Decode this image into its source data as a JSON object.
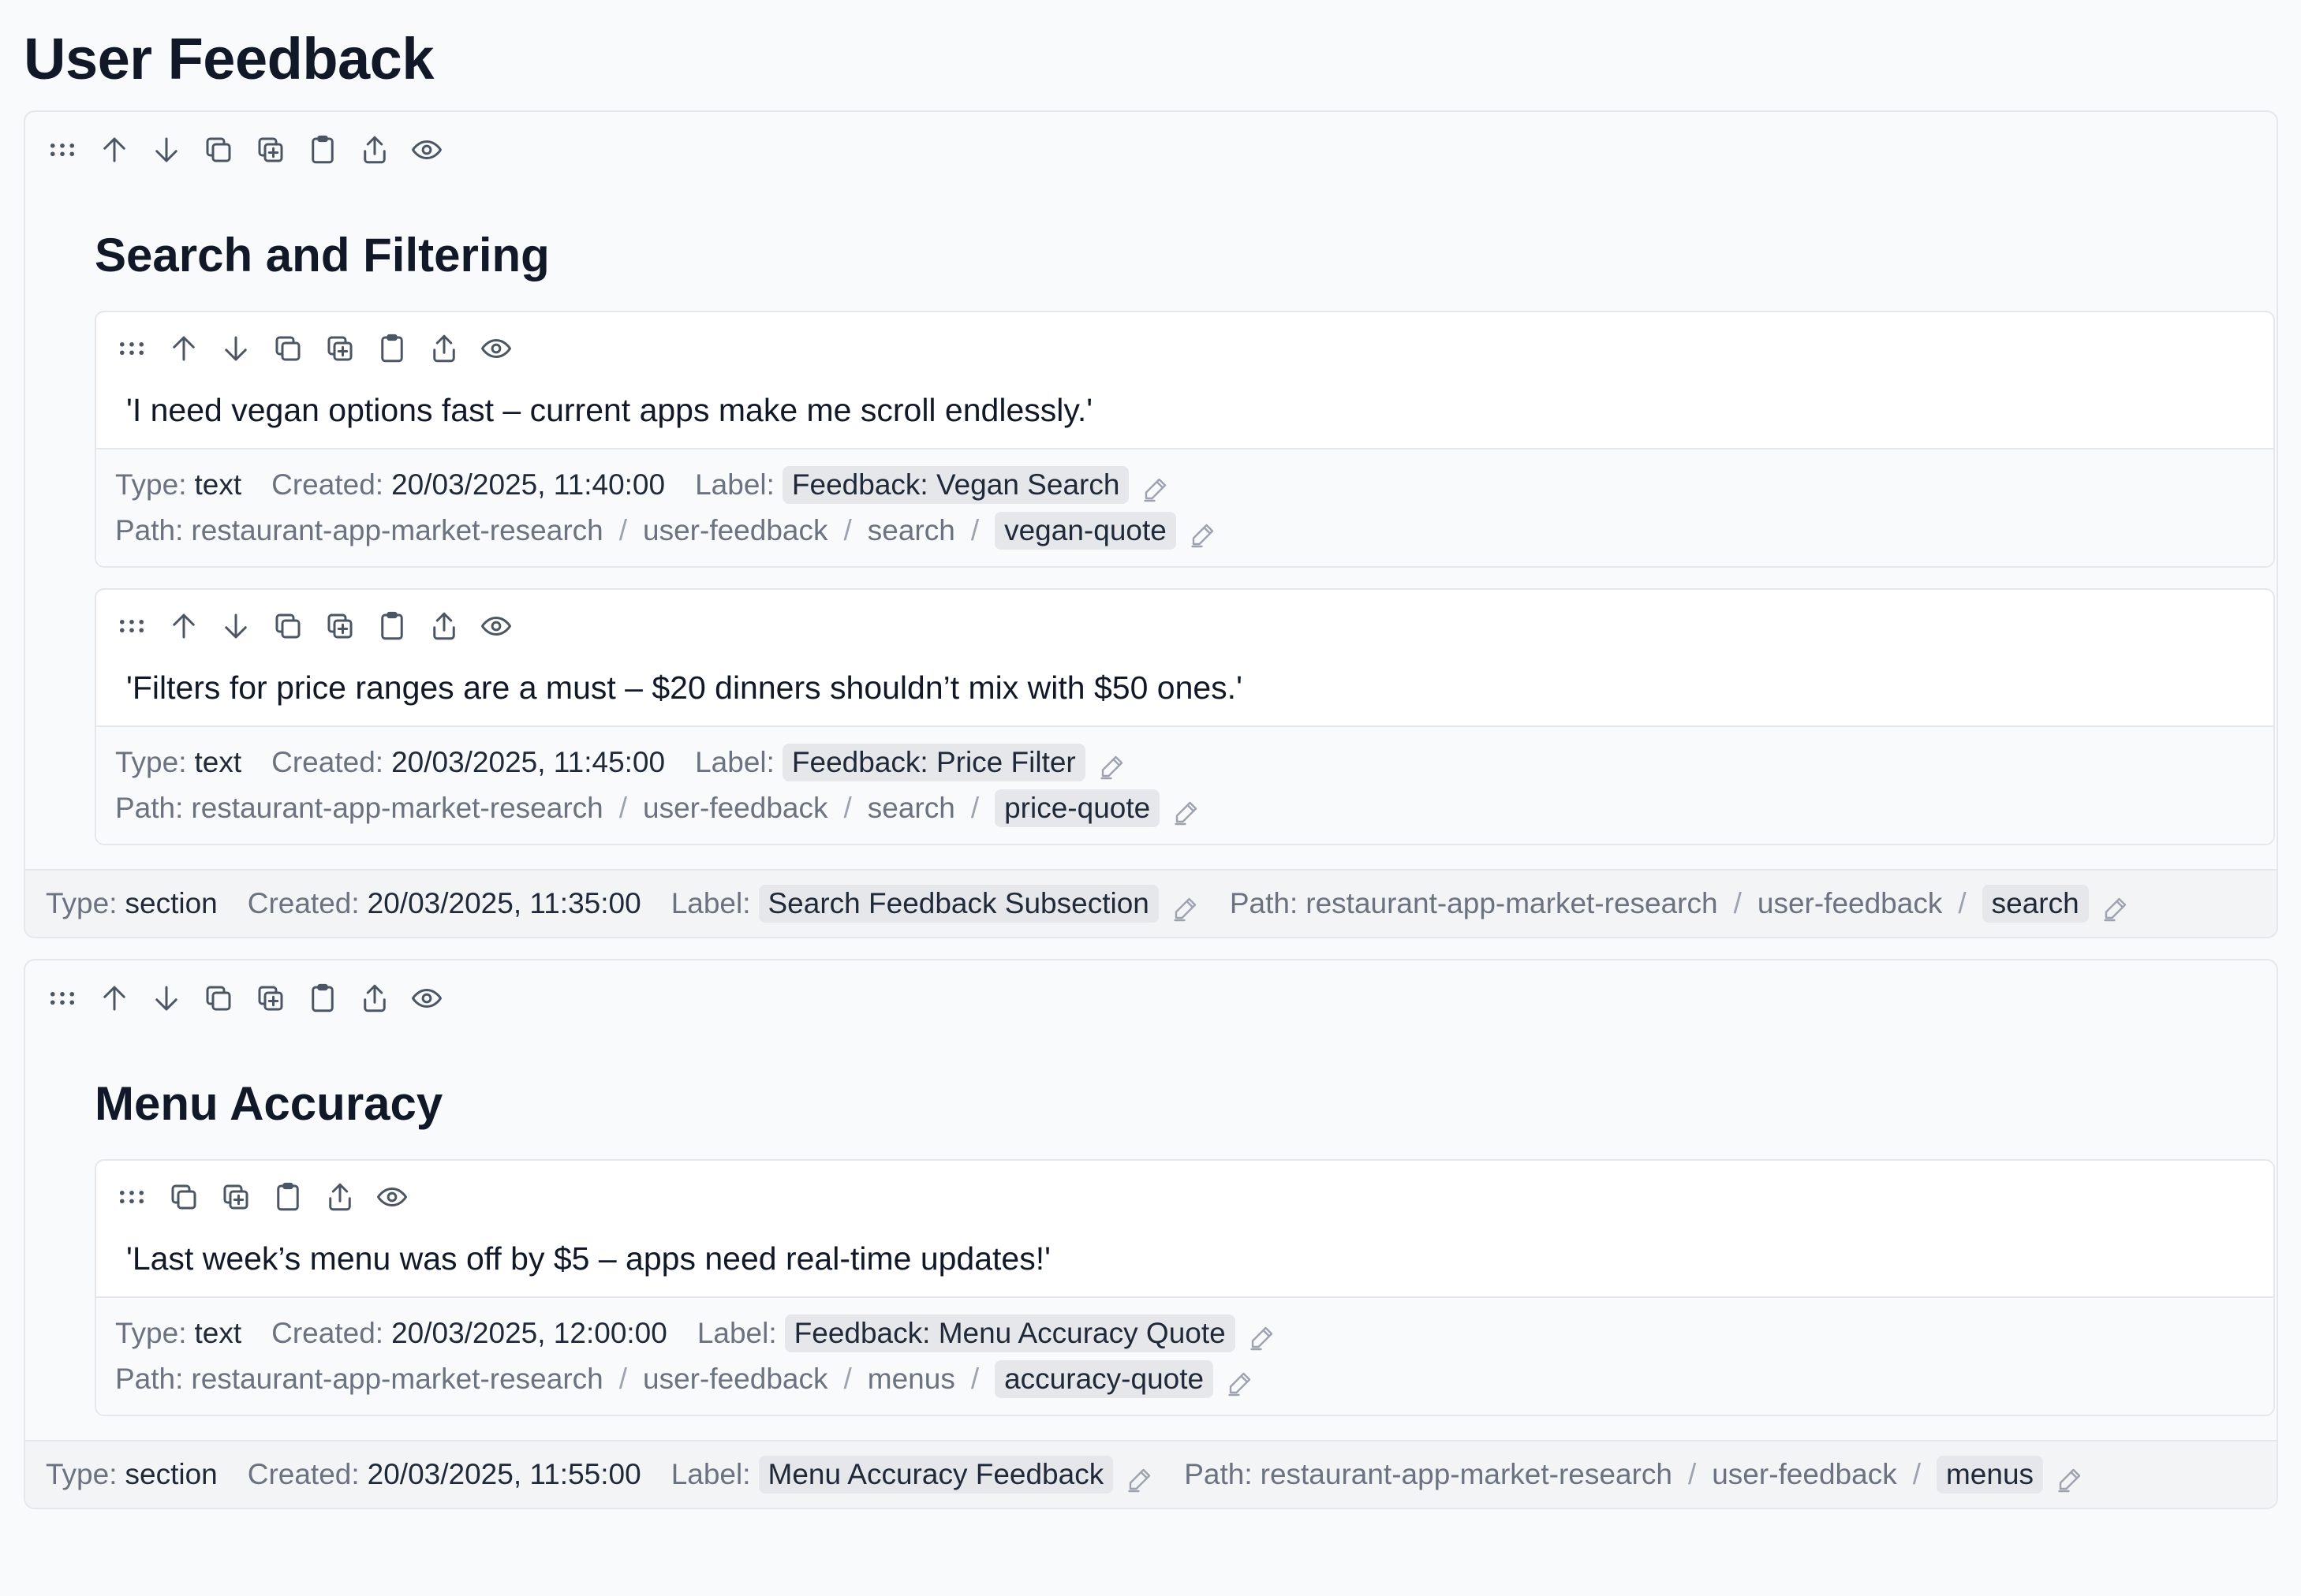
{
  "page": {
    "title": "User Feedback"
  },
  "labels": {
    "type": "Type:",
    "created": "Created:",
    "label": "Label:",
    "path": "Path:",
    "sep": "/"
  },
  "sections": [
    {
      "title": "Search and Filtering",
      "meta": {
        "type": "section",
        "created": "20/03/2025, 11:35:00",
        "label": "Search Feedback Subsection",
        "path": [
          "restaurant-app-market-research",
          "user-feedback"
        ],
        "slug": "search"
      },
      "blocks": [
        {
          "text": "'I need vegan options fast – current apps make me scroll endlessly.'",
          "type": "text",
          "created": "20/03/2025, 11:40:00",
          "label": "Feedback: Vegan Search",
          "path": [
            "restaurant-app-market-research",
            "user-feedback",
            "search"
          ],
          "slug": "vegan-quote"
        },
        {
          "text": "'Filters for price ranges are a must – $20 dinners shouldn’t mix with $50 ones.'",
          "type": "text",
          "created": "20/03/2025, 11:45:00",
          "label": "Feedback: Price Filter",
          "path": [
            "restaurant-app-market-research",
            "user-feedback",
            "search"
          ],
          "slug": "price-quote"
        }
      ]
    },
    {
      "title": "Menu Accuracy",
      "meta": {
        "type": "section",
        "created": "20/03/2025, 11:55:00",
        "label": "Menu Accuracy Feedback",
        "path": [
          "restaurant-app-market-research",
          "user-feedback"
        ],
        "slug": "menus"
      },
      "blocks": [
        {
          "text": "'Last week’s menu was off by $5 – apps need real-time updates!'",
          "type": "text",
          "created": "20/03/2025, 12:00:00",
          "label": "Feedback: Menu Accuracy Quote",
          "path": [
            "restaurant-app-market-research",
            "user-feedback",
            "menus"
          ],
          "slug": "accuracy-quote"
        }
      ]
    }
  ],
  "icons": {
    "toolbar_full": [
      "drag-handle-icon",
      "arrow-up-icon",
      "arrow-down-icon",
      "copy-icon",
      "duplicate-icon",
      "clipboard-icon",
      "export-icon",
      "eye-icon"
    ],
    "toolbar_short": [
      "drag-handle-icon",
      "copy-icon",
      "duplicate-icon",
      "clipboard-icon",
      "export-icon",
      "eye-icon"
    ],
    "edit": "pencil-icon"
  }
}
